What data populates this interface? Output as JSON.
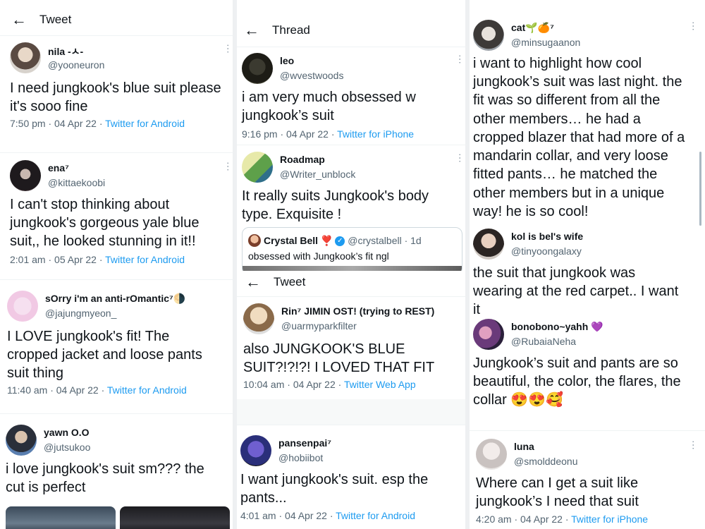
{
  "col1": {
    "header": {
      "back": "←",
      "title": "Tweet"
    },
    "tweets": [
      {
        "name": "nila -ㅅ-",
        "handle": "@yooneuron",
        "line1": "I need jungkook's blue suit please",
        "line2": "it's sooo fine",
        "time": "7:50 pm · 04 Apr 22 · ",
        "source": "Twitter for Android"
      },
      {
        "name": "ena⁷",
        "handle": "@kittaekoobi",
        "line1": "I can't stop thinking about",
        "line2": "jungkook's gorgeous yale blue",
        "line3": "suit,, he looked stunning in it!!",
        "time": "2:01 am · 05 Apr 22 · ",
        "source": "Twitter for Android"
      },
      {
        "name": "sOrry i'm an anti-rOmantic⁷🌗",
        "handle": "@jajungmyeon_",
        "line1": "I LOVE jungkook's fit! The",
        "line2": "cropped jacket and loose pants",
        "line3": "suit thing",
        "time": "11:40 am · 04 Apr 22 · ",
        "source": "Twitter for Android"
      },
      {
        "name": "yawn O.O",
        "handle": "@jutsukoo",
        "line1": "i love jungkook's suit sm??? the",
        "line2": "cut is perfect"
      }
    ]
  },
  "col2": {
    "header": {
      "back": "←",
      "title": "Thread"
    },
    "tweets": [
      {
        "name": "leo",
        "handle": "@wvestwoods",
        "line1": "i am very much obsessed w",
        "line2": "jungkook’s suit",
        "time": "9:16 pm · 04 Apr 22 · ",
        "source": "Twitter for iPhone"
      },
      {
        "name": "Roadmap",
        "handle": "@Writer_unblock",
        "line1": "It really suits Jungkook's body",
        "line2": "type. Exquisite !"
      }
    ],
    "quote": {
      "name": "Crystal Bell ❣️",
      "verified": "✓",
      "handle": "@crystalbell · 1d",
      "text": "obsessed with Jungkook’s fit ngl"
    },
    "header2": {
      "back": "←",
      "title": "Tweet"
    },
    "tweets2": [
      {
        "name": "Rin⁷ JIMIN OST! (trying to REST)",
        "handle": "@uarmyparkfilter",
        "line1": "also JUNGKOOK'S BLUE",
        "line2": "SUIT?!?!?! I LOVED THAT FIT",
        "time": "10:04 am · 04 Apr 22 · ",
        "source": "Twitter Web App"
      },
      {
        "name": "pansenpai⁷",
        "handle": "@hobiibot",
        "line1": "I want jungkook's suit. esp the",
        "line2": "pants...",
        "time": "4:01 am · 04 Apr 22 · ",
        "source": "Twitter for Android"
      }
    ]
  },
  "col3": {
    "tweets": [
      {
        "name": "cat🌱🍊⁷",
        "handle": "@minsugaanon",
        "lines": [
          "i want to highlight how cool",
          "jungkook’s suit was last night. the",
          "fit was so different from all the",
          "other members… he had a",
          "cropped blazer that had more of a",
          "mandarin collar, and very loose",
          "fitted pants… he matched the",
          "other members but in a unique",
          "way! he is so cool!"
        ]
      },
      {
        "name": "kol is bel's wife",
        "handle": "@tinyoongalaxy",
        "lines": [
          "the suit that jungkook was",
          "wearing at the red carpet.. I want",
          "it"
        ]
      },
      {
        "name": "bonobono~yahh 💜",
        "handle": "@RubaiaNeha",
        "lines": [
          "Jungkook’s suit and pants are so",
          "beautiful, the color, the flares, the",
          "collar 😍😍🥰"
        ]
      },
      {
        "name": "luna",
        "handle": "@smolddeonu",
        "lines": [
          "Where can I get a suit like",
          "jungkook’s I need that suit"
        ],
        "time": "4:20 am · 04 Apr 22 · ",
        "source": "Twitter for iPhone"
      }
    ]
  },
  "icons": {
    "more": "⋯"
  },
  "colors": {
    "link": "#1d9bf0",
    "text": "#0f1419",
    "muted": "#536471"
  }
}
